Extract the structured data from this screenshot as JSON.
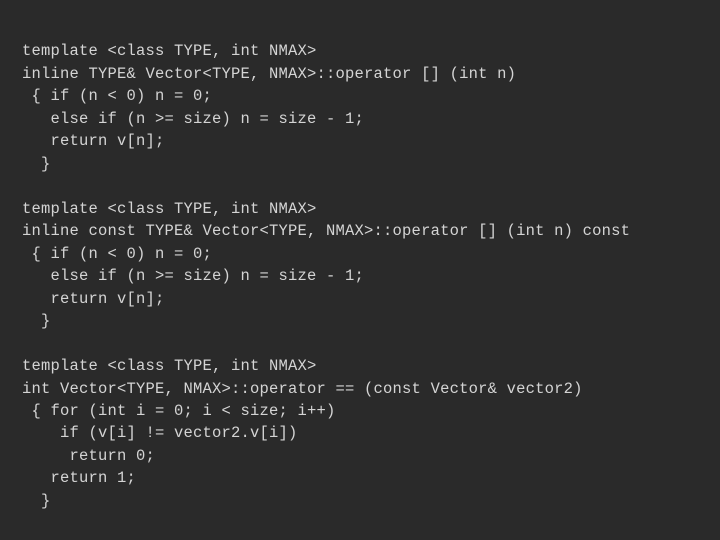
{
  "code": {
    "lines": [
      "template <class TYPE, int NMAX>",
      "inline TYPE& Vector<TYPE, NMAX>::operator [] (int n)",
      " { if (n < 0) n = 0;",
      "   else if (n >= size) n = size - 1;",
      "   return v[n];",
      "  }",
      "",
      "template <class TYPE, int NMAX>",
      "inline const TYPE& Vector<TYPE, NMAX>::operator [] (int n) const",
      " { if (n < 0) n = 0;",
      "   else if (n >= size) n = size - 1;",
      "   return v[n];",
      "  }",
      "",
      "template <class TYPE, int NMAX>",
      "int Vector<TYPE, NMAX>::operator == (const Vector& vector2)",
      " { for (int i = 0; i < size; i++)",
      "    if (v[i] != vector2.v[i])",
      "     return 0;",
      "   return 1;",
      "  }"
    ]
  }
}
